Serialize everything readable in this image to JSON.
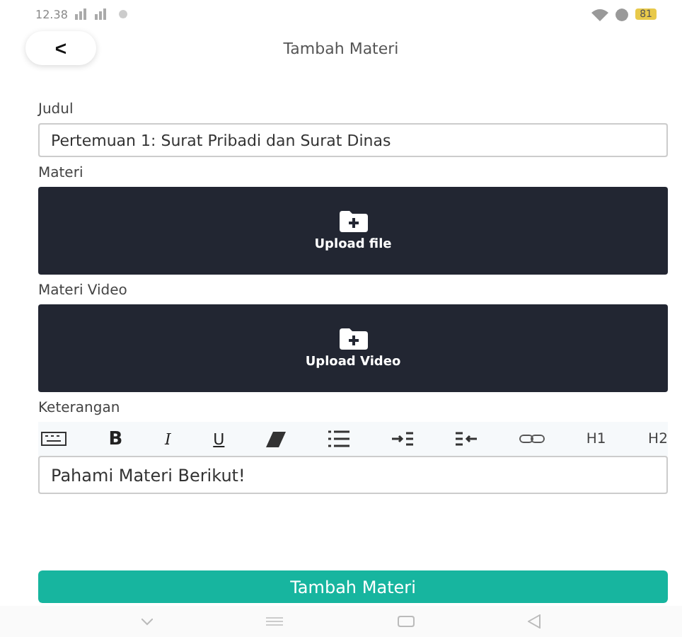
{
  "status_bar": {
    "time": "12.38",
    "battery": "81"
  },
  "header": {
    "back": "<",
    "title": "Tambah Materi"
  },
  "judul": {
    "label": "Judul",
    "value": "Pertemuan 1: Surat Pribadi dan Surat Dinas"
  },
  "uploads": [
    {
      "label": "Materi",
      "button": "Upload file"
    },
    {
      "label": "Materi Video",
      "button": "Upload Video"
    }
  ],
  "keterangan": {
    "label": "Keterangan",
    "toolbar": [
      {
        "kind": "keyboard"
      },
      {
        "kind": "bold",
        "label": "B"
      },
      {
        "kind": "italic",
        "label": "I"
      },
      {
        "kind": "underline",
        "label": "U"
      },
      {
        "kind": "eraser"
      },
      {
        "kind": "list"
      },
      {
        "kind": "indent"
      },
      {
        "kind": "outdent"
      },
      {
        "kind": "link"
      },
      {
        "kind": "heading",
        "label": "H1"
      },
      {
        "kind": "heading",
        "label": "H2"
      }
    ],
    "value": "Pahami Materi Berikut!"
  },
  "submit": "Tambah Materi"
}
